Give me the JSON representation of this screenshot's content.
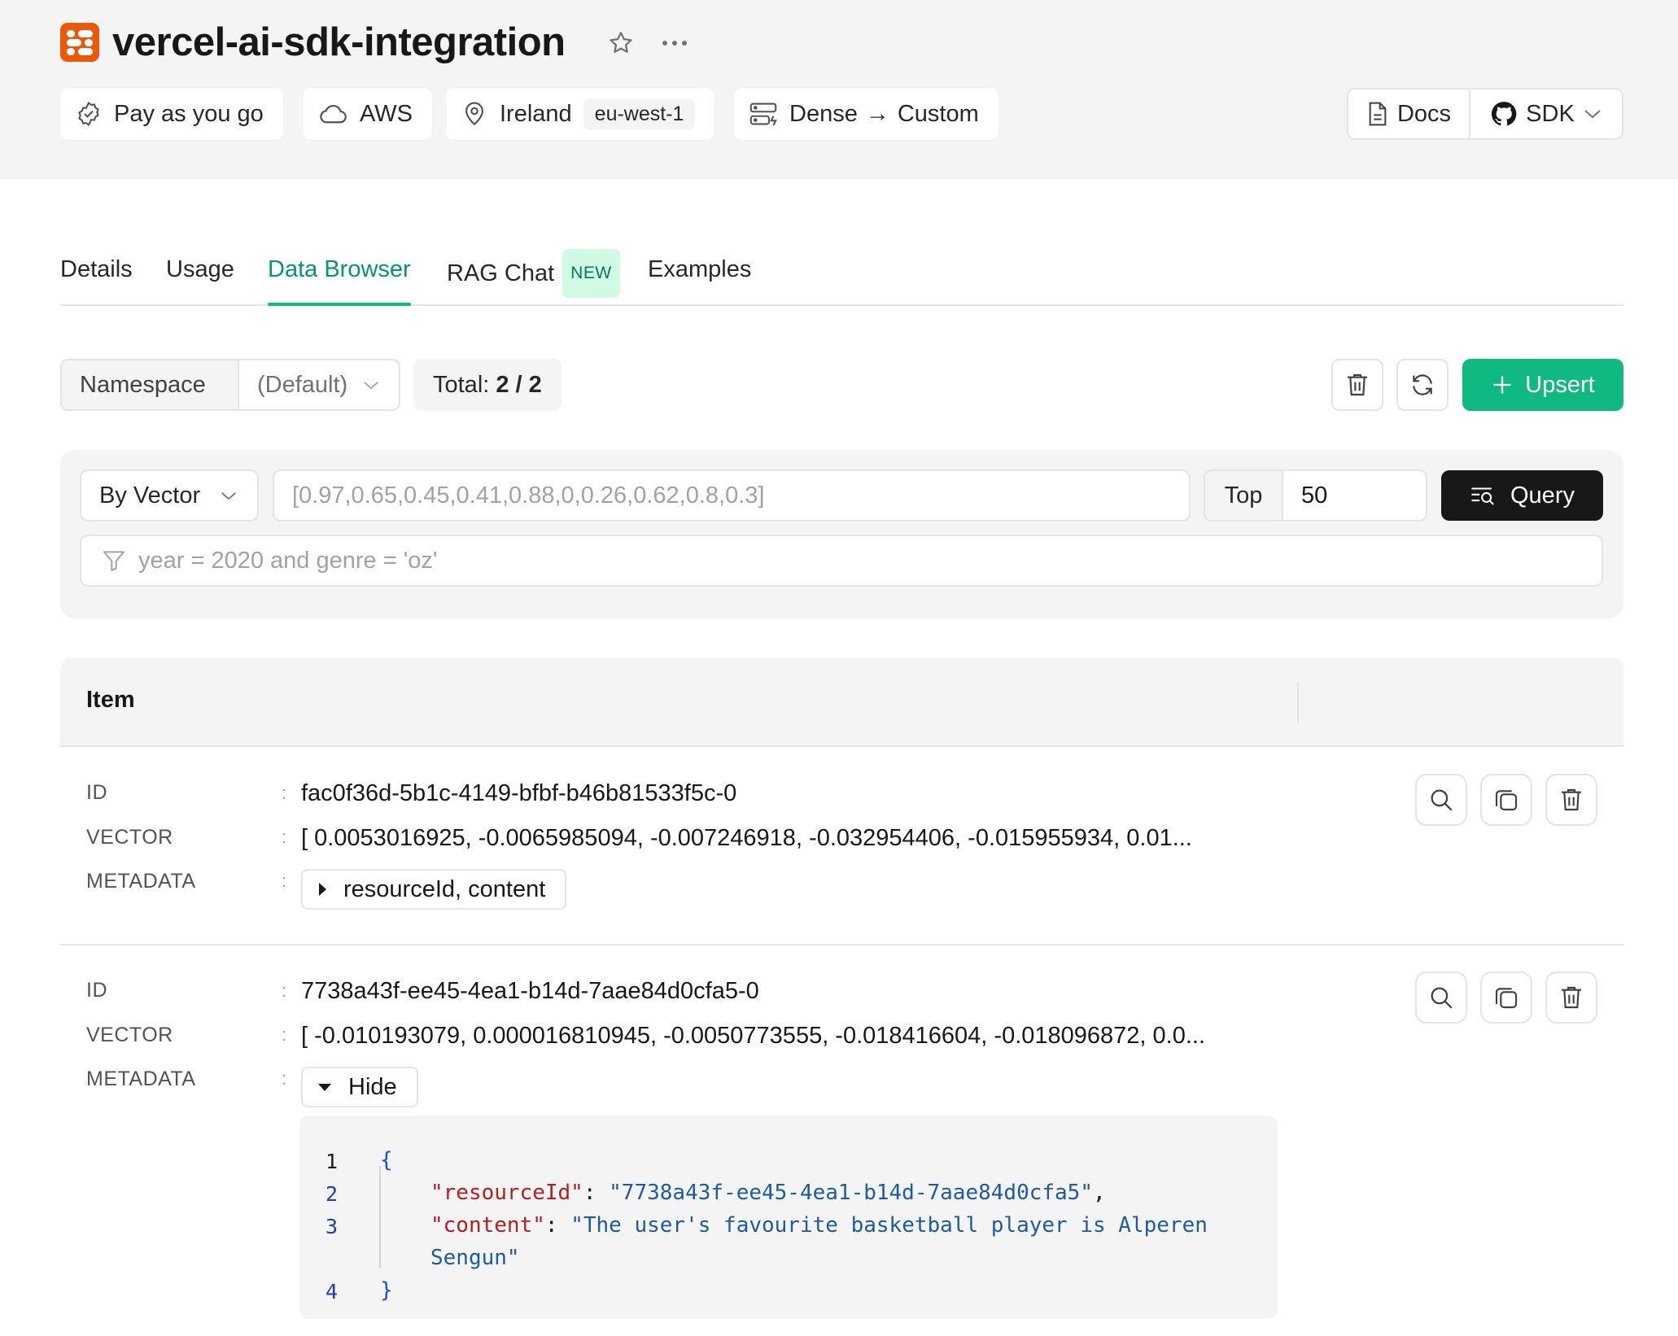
{
  "header": {
    "title": "vercel-ai-sdk-integration",
    "brand_color": "#ea580c",
    "chips": {
      "plan": "Pay as you go",
      "cloud": "AWS",
      "region_name": "Ireland",
      "region_code": "eu-west-1",
      "index_from": "Dense",
      "index_arrow": "→",
      "index_to": "Custom"
    },
    "docs_label": "Docs",
    "sdk_label": "SDK"
  },
  "tabs": [
    {
      "label": "Details",
      "active": false
    },
    {
      "label": "Usage",
      "active": false
    },
    {
      "label": "Data Browser",
      "active": true
    },
    {
      "label": "RAG Chat",
      "badge": "NEW",
      "active": false
    },
    {
      "label": "Examples",
      "active": false
    }
  ],
  "toolbar": {
    "namespace_label": "Namespace",
    "namespace_value": "(Default)",
    "total_label": "Total:",
    "total_value": "2 / 2",
    "upsert_label": "Upsert",
    "accent_color": "#10b981"
  },
  "query": {
    "mode": "By Vector",
    "vector_placeholder": "[0.97,0.65,0.45,0.41,0.88,0,0.26,0.62,0.8,0.3]",
    "top_label": "Top",
    "top_value": "50",
    "query_label": "Query",
    "filter_placeholder": "year = 2020 and genre = 'oz'"
  },
  "table": {
    "header": "Item",
    "labels": {
      "id": "ID",
      "vector": "VECTOR",
      "metadata": "METADATA",
      "colon": ":"
    },
    "rows": [
      {
        "id": "fac0f36d-5b1c-4149-bfbf-b46b81533f5c-0",
        "vector": "[ 0.0053016925, -0.0065985094, -0.007246918, -0.032954406, -0.015955934, 0.01...",
        "metadata_toggle": "resourceId, content"
      },
      {
        "id": "7738a43f-ee45-4ea1-b14d-7aae84d0cfa5-0",
        "vector": "[ -0.010193079, 0.000016810945, -0.0050773555, -0.018416604, -0.018096872, 0.0...",
        "metadata_toggle": "Hide",
        "metadata_json": {
          "line_numbers": [
            "1",
            "2",
            "3",
            "4"
          ],
          "open_brace": "{",
          "key1": "\"resourceId\"",
          "val1": "\"7738a43f-ee45-4ea1-b14d-7aae84d0cfa5\"",
          "key2": "\"content\"",
          "val2_line1": "\"The user's favourite basketball player is Alperen",
          "val2_line2": "Sengun\"",
          "close_brace": "}"
        }
      }
    ]
  }
}
